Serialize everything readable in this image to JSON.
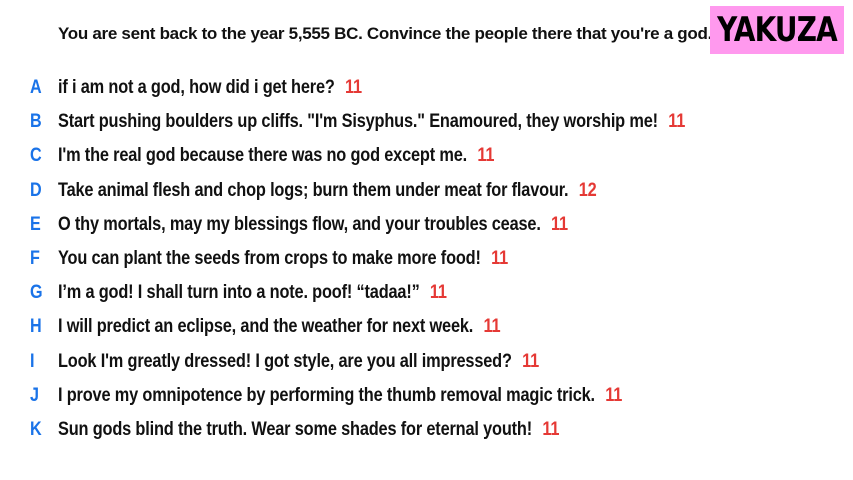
{
  "prompt": "You are sent back to the year 5,555 BC. Convince the people there that you're a god.",
  "badge": "YAKUZA",
  "colors": {
    "letter": "#1a73e8",
    "score": "#e53935",
    "badge_bg": "#ff99ee",
    "text": "#111111"
  },
  "answers": [
    {
      "letter": "A",
      "text": "if i am not a god, how did i get here?",
      "score": "11"
    },
    {
      "letter": "B",
      "text": "Start pushing boulders up cliffs. \"I'm Sisyphus.\" Enamoured, they worship me!",
      "score": "11"
    },
    {
      "letter": "C",
      "text": "I'm the real god because there was no god except me.",
      "score": "11"
    },
    {
      "letter": "D",
      "text": "Take animal flesh and chop logs; burn them under meat for flavour.",
      "score": "12"
    },
    {
      "letter": "E",
      "text": "O thy mortals, may my blessings flow, and your troubles cease.",
      "score": "11"
    },
    {
      "letter": "F",
      "text": "You can plant the seeds from crops to make more food!",
      "score": "11"
    },
    {
      "letter": "G",
      "text": "I’m a god! I shall turn into a note. poof! “tadaa!”",
      "score": "11"
    },
    {
      "letter": "H",
      "text": "I will predict an eclipse, and the weather for next week.",
      "score": "11"
    },
    {
      "letter": "I",
      "text": "Look I'm greatly dressed! I got style, are you all impressed?",
      "score": "11"
    },
    {
      "letter": "J",
      "text": "I prove my omnipotence by performing the thumb removal magic trick.",
      "score": "11"
    },
    {
      "letter": "K",
      "text": "Sun gods blind the truth. Wear some shades for eternal youth!",
      "score": "11"
    }
  ]
}
